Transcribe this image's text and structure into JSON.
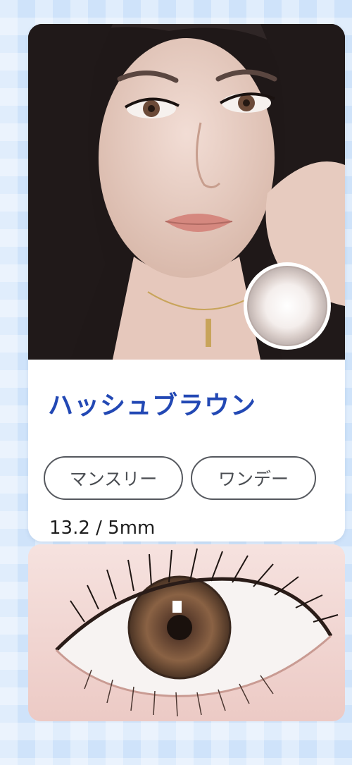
{
  "product": {
    "name": "ハッシュブラウン",
    "tags": [
      "マンスリー",
      "ワンデー"
    ],
    "spec": "13.2 / 5mm"
  },
  "colors": {
    "background": "#cfe3fa",
    "title": "#2248b4",
    "tag_border": "#55585e",
    "card": "#ffffff"
  }
}
